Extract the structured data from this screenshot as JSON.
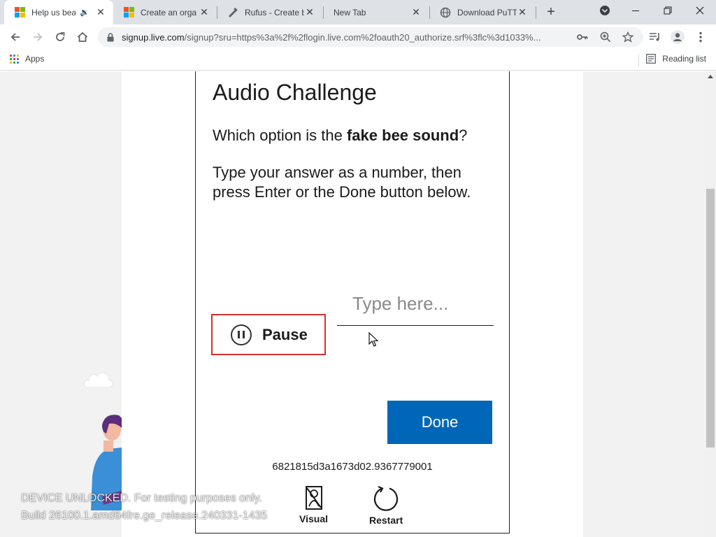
{
  "browser": {
    "tabs": [
      {
        "title": "Help us bea",
        "favicon": "microsoft-logo",
        "audio": "🔉",
        "active": true
      },
      {
        "title": "Create an orga",
        "favicon": "microsoft-logo",
        "active": false
      },
      {
        "title": "Rufus - Create b",
        "favicon": "rufus-icon",
        "active": false
      },
      {
        "title": "New Tab",
        "favicon": "",
        "active": false
      },
      {
        "title": "Download PuTT",
        "favicon": "globe-icon",
        "active": false
      }
    ],
    "new_tab_glyph": "+",
    "window_controls": {
      "minimize": "—",
      "restore": "❐",
      "close": "✕"
    },
    "url_host": "signup.live.com",
    "url_rest": "/signup?sru=https%3a%2f%2flogin.live.com%2foauth20_authorize.srf%3flc%3d1033%...",
    "bookmarks": {
      "apps_label": "Apps",
      "reading_list_label": "Reading list"
    }
  },
  "challenge": {
    "title": "Audio Challenge",
    "question_prefix": "Which option is the ",
    "question_bold": "fake bee sound",
    "question_suffix": "?",
    "instructions": "Type your answer as a number, then press Enter or the Done button below.",
    "pause_label": "Pause",
    "answer_placeholder": "Type here...",
    "done_label": "Done",
    "session_id": "6821815d3a1673d02.9367779001",
    "visual_label": "Visual",
    "restart_label": "Restart"
  },
  "watermark": {
    "line1": "DEVICE UNLOCKED. For testing purposes only.",
    "line2": "Build 26100.1.amd64fre.ge_release.240331-1435"
  },
  "colors": {
    "accent_blue": "#0067b8",
    "highlight_red": "#d32f2f",
    "ms_red": "#f25022",
    "ms_green": "#7fba00",
    "ms_blue": "#00a4ef",
    "ms_yellow": "#ffb900"
  }
}
